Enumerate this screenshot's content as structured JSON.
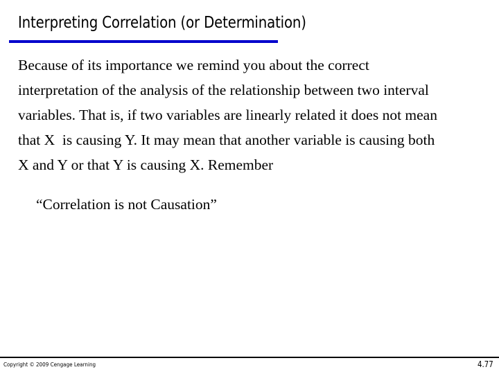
{
  "slide": {
    "title": "Interpreting Correlation (or Determination)",
    "accent_color": "#0000cc",
    "body_lines": [
      "Because of its importance we remind you about the correct",
      "interpretation of the analysis of the relationship between two interval",
      "variables. That is, if two variables are linearly related it does not mean",
      "that X  is causing Y. It may mean that another variable is causing both",
      "X and Y or that Y is causing X. Remember"
    ],
    "quote": "“Correlation is not Causation”"
  },
  "footer": {
    "copyright": "Copyright © 2009 Cengage Learning",
    "page_number": "4.77"
  }
}
